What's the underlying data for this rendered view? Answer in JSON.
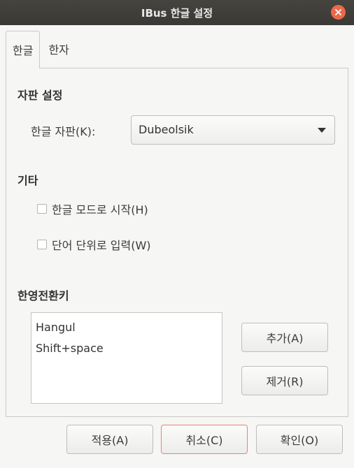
{
  "window": {
    "title": "IBus 한글 설정"
  },
  "tabs": [
    {
      "label": "한글",
      "active": true
    },
    {
      "label": "한자",
      "active": false
    }
  ],
  "layout_section": {
    "heading": "자판 설정",
    "keyboard_label": "한글 자판(K):",
    "keyboard_value": "Dubeolsik"
  },
  "etc_section": {
    "heading": "기타",
    "options": [
      {
        "label": "한글 모드로 시작(H)",
        "checked": false
      },
      {
        "label": "단어 단위로 입력(W)",
        "checked": false
      }
    ]
  },
  "hotkey_section": {
    "heading": "한영전환키",
    "keys": [
      "Hangul",
      "Shift+space"
    ],
    "add_label": "추가(A)",
    "remove_label": "제거(R)"
  },
  "footer": {
    "apply_label": "적용(A)",
    "cancel_label": "취소(C)",
    "ok_label": "확인(O)"
  },
  "colors": {
    "titlebar": "#3c3b37",
    "close_button": "#e9694a",
    "focus_border": "#e9856b"
  }
}
